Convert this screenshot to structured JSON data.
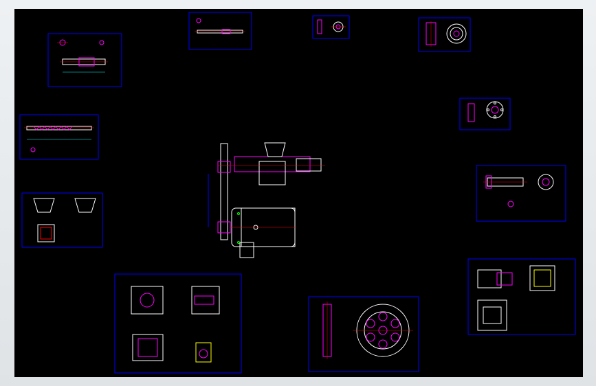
{
  "colors": {
    "background": "#000000",
    "frame": "#0000ff",
    "outline": "#ffffff",
    "highlight": "#ff00ff",
    "dimension": "#00ffff",
    "centerline": "#ff0000",
    "marker": "#00ff00",
    "hatch": "#ffff00"
  },
  "sheets": [
    {
      "id": "shaft-assembly",
      "label": ""
    },
    {
      "id": "long-shaft",
      "label": ""
    },
    {
      "id": "bushing",
      "label": ""
    },
    {
      "id": "flange-disc",
      "label": ""
    },
    {
      "id": "screw-shaft",
      "label": ""
    },
    {
      "id": "bearing-cap",
      "label": ""
    },
    {
      "id": "hopper",
      "label": ""
    },
    {
      "id": "sleeve-shaft",
      "label": ""
    },
    {
      "id": "gearbox-housing",
      "label": ""
    },
    {
      "id": "pulley",
      "label": ""
    },
    {
      "id": "housing-block",
      "label": ""
    }
  ]
}
